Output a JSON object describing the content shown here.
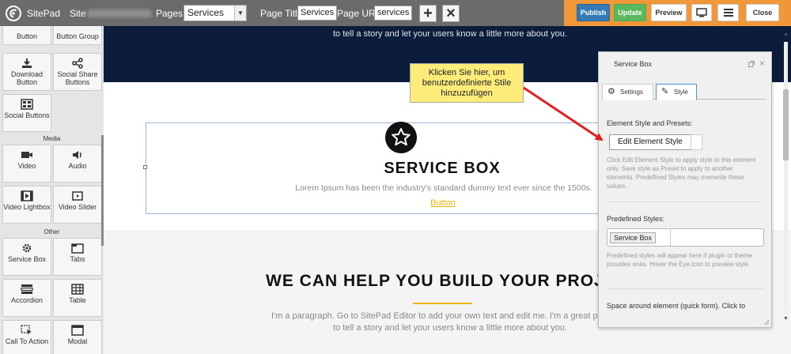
{
  "topbar": {
    "brand": "SitePad",
    "site_label": "Site :",
    "pages_label": "Pages :",
    "pages_value": "Services",
    "page_title_label": "Page Title:",
    "page_title_value": "Services",
    "page_url_label": "Page URL:",
    "page_url_value": "services",
    "add_label": "+",
    "close_x_label": "×",
    "publish": "Publish",
    "update": "Update",
    "preview": "Preview",
    "close": "Close",
    "colors": {
      "bar": "#6b6b6b",
      "accent": "#f0973a",
      "publish": "#337ab7",
      "update": "#5cb85c"
    }
  },
  "widgets": {
    "items": [
      {
        "label": "Button",
        "icon": "button-icon"
      },
      {
        "label": "Button Group",
        "icon": "button-group-icon"
      },
      {
        "label": "Download Button",
        "icon": "download-icon"
      },
      {
        "label": "Social Share Buttons",
        "icon": "share-icon"
      },
      {
        "label": "Social Buttons",
        "icon": "social-buttons-icon"
      }
    ],
    "media_category": "Media",
    "media": [
      {
        "label": "Video",
        "icon": "video-icon"
      },
      {
        "label": "Audio",
        "icon": "audio-icon"
      },
      {
        "label": "Video Lightbox",
        "icon": "film-icon"
      },
      {
        "label": "Video Slider",
        "icon": "video-slider-icon"
      }
    ],
    "other_category": "Other",
    "other": [
      {
        "label": "Service Box",
        "icon": "gear-icon"
      },
      {
        "label": "Tabs",
        "icon": "tabs-icon"
      },
      {
        "label": "Accordion",
        "icon": "accordion-icon"
      },
      {
        "label": "Table",
        "icon": "table-icon"
      },
      {
        "label": "Call To Action",
        "icon": "cursor-icon"
      },
      {
        "label": "Modal",
        "icon": "modal-icon"
      }
    ]
  },
  "canvas": {
    "top_text": "to tell a story and let your users know a little more about you.",
    "service_title": "SERVICE BOX",
    "service_desc": "Lorem Ipsum has been the industry's standard dummy text ever since the 1500s.",
    "service_button": "Button",
    "help_heading": "WE CAN HELP YOU BUILD YOUR PROJEC",
    "help_p1": "I'm a paragraph. Go to SitePad Editor to add your own text and edit me. I'm a great place for you",
    "help_p2": "to tell a story and let your users know a little more about you."
  },
  "callout": {
    "text": "Klicken Sie hier, um benutzerdefinierte Stile hinzuzufügen",
    "bg_color": "#fdeb7a",
    "arrow_color": "#e02020"
  },
  "panel": {
    "title": "Service Box",
    "tab_settings": "Settings",
    "tab_style": "Style",
    "element_style_label": "Element Style and Presets:",
    "edit_button": "Edit Element Style",
    "edit_note": "Click Edit Element Style to apply style to this element only. Save style as Preset to apply to another elements. Predefined Styles may overwrite these values.",
    "predefined_label": "Predefined Styles:",
    "preset_value": "Service Box",
    "predefined_note": "Predefined styles will appear here if plugin or theme provides ones. Hover the Eye icon to preview style.",
    "space_label": "Space around element (quick form). Click to"
  }
}
